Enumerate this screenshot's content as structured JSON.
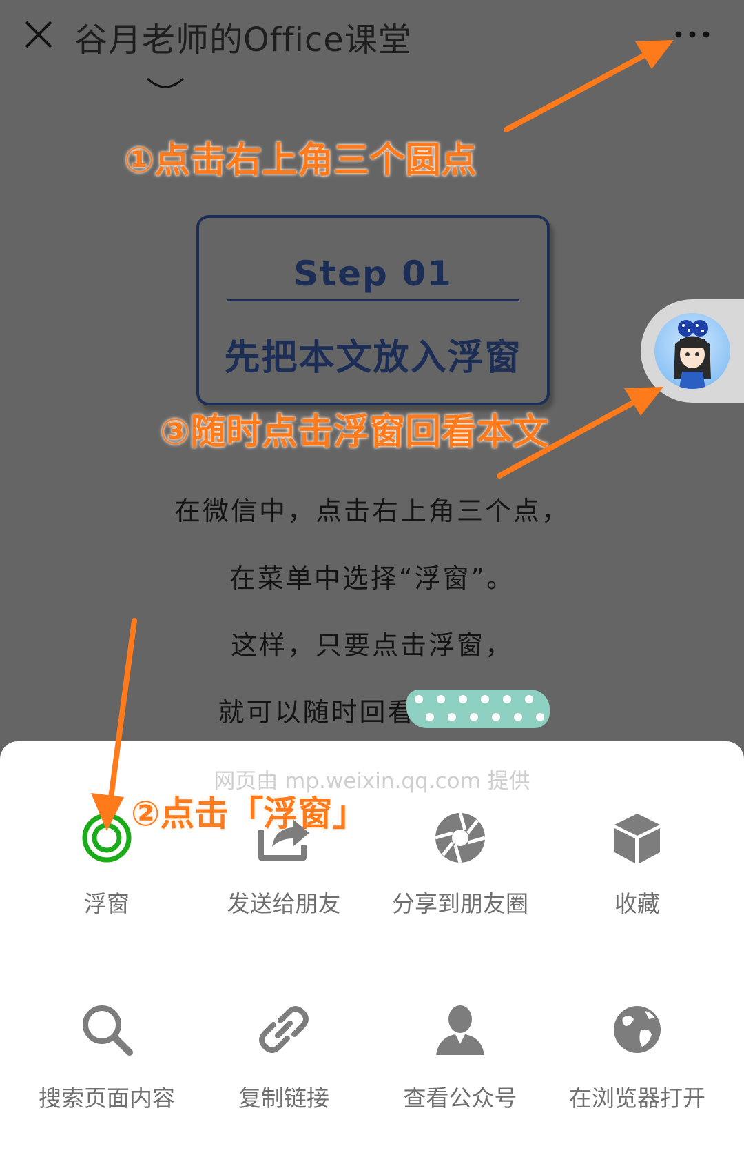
{
  "header": {
    "title": "谷月老师的Office课堂"
  },
  "annotations": {
    "step1": "①点击右上角三个圆点",
    "step2": "②点击「浮窗」",
    "step3": "③随时点击浮窗回看本文"
  },
  "step_card": {
    "title": "Step 01",
    "subtitle": "先把本文放入浮窗"
  },
  "article": {
    "lines": [
      "在微信中，点击右上角三个点，",
      "在菜单中选择“浮窗”。",
      "这样，只要点击浮窗，",
      "就可以随时回看"
    ]
  },
  "sheet": {
    "provider": "网页由 mp.weixin.qq.com 提供",
    "actions": [
      {
        "label": "浮窗",
        "icon": "floating-window-icon"
      },
      {
        "label": "发送给朋友",
        "icon": "share-arrow-icon"
      },
      {
        "label": "分享到朋友圈",
        "icon": "moments-shutter-icon"
      },
      {
        "label": "收藏",
        "icon": "cube-icon"
      },
      {
        "label": "搜索页面内容",
        "icon": "search-icon"
      },
      {
        "label": "复制链接",
        "icon": "link-icon"
      },
      {
        "label": "查看公众号",
        "icon": "person-icon"
      },
      {
        "label": "在浏览器打开",
        "icon": "globe-icon"
      }
    ]
  },
  "colors": {
    "annotation": "#ff7a1a",
    "card_border": "#1c2e56",
    "float_icon_green": "#1aad19",
    "icon_gray": "#7d7d7d"
  }
}
